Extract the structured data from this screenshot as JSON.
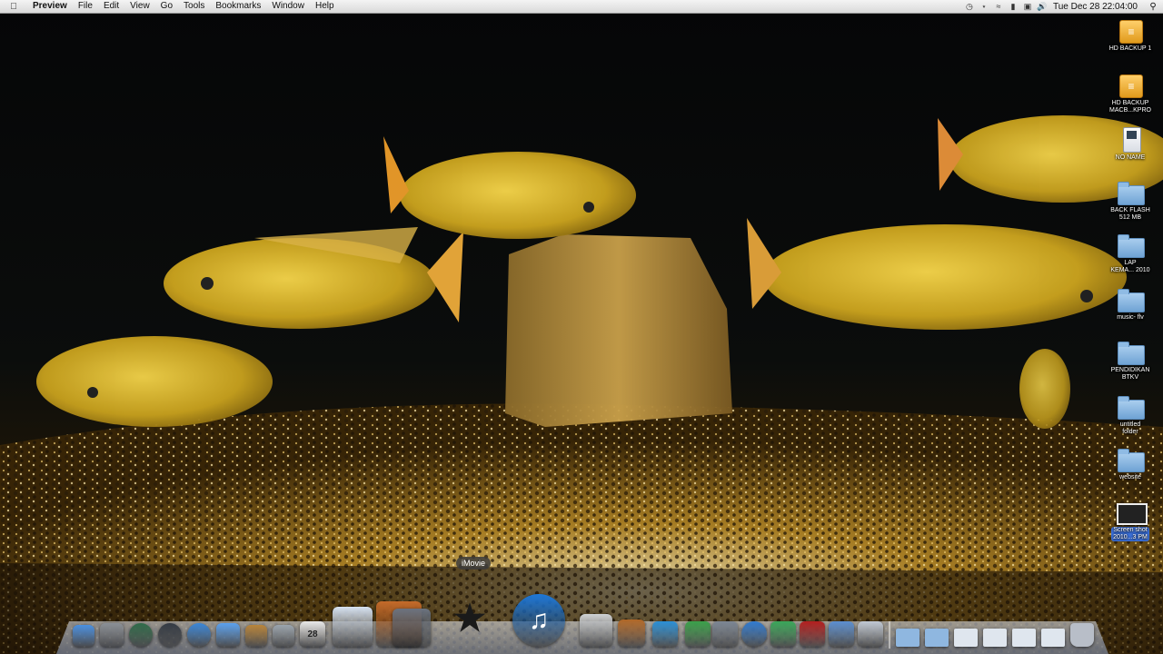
{
  "menubar": {
    "app_name": "Preview",
    "items": [
      "File",
      "Edit",
      "View",
      "Go",
      "Tools",
      "Bookmarks",
      "Window",
      "Help"
    ],
    "status_icons": [
      "time-machine-icon",
      "bluetooth-icon",
      "wifi-icon",
      "battery-icon",
      "keyboard-flag-icon",
      "volume-icon"
    ],
    "clock": "Tue Dec 28  22:04:00"
  },
  "desktop": {
    "items": [
      {
        "label": "HD BACKUP 1",
        "kind": "usb-drive-icon"
      },
      {
        "label": "HD BACKUP\nMACB...KPRO",
        "kind": "usb-drive-icon"
      },
      {
        "label": "NO NAME",
        "kind": "sd-card-icon"
      },
      {
        "label": "BACK FLASH\n512 MB",
        "kind": "folder-icon"
      },
      {
        "label": "LAP\nKEMA... 2010",
        "kind": "folder-icon"
      },
      {
        "label": "music- flv",
        "kind": "folder-icon"
      },
      {
        "label": "PENDIDIKAN\nBTKV",
        "kind": "folder-icon"
      },
      {
        "label": "untitled\nfolder",
        "kind": "folder-icon"
      },
      {
        "label": "website",
        "kind": "folder-icon"
      },
      {
        "label": "Screen shot\n2010...3 PM",
        "kind": "screenshot-file-icon"
      }
    ]
  },
  "dock": {
    "tooltip": "iMovie",
    "apps": [
      {
        "name": "finder-icon",
        "color": "#4a8fe0"
      },
      {
        "name": "system-preferences-icon",
        "color": "#8a8f96"
      },
      {
        "name": "time-machine-icon",
        "color": "#2f6b4a"
      },
      {
        "name": "dashboard-icon",
        "color": "#333a44"
      },
      {
        "name": "safari-icon",
        "color": "#3a86d8"
      },
      {
        "name": "ichat-icon",
        "color": "#5aa0ee"
      },
      {
        "name": "address-book-icon",
        "color": "#b8843a"
      },
      {
        "name": "sync-icon",
        "color": "#9aa4ae"
      },
      {
        "name": "ical-icon",
        "color": "#e9e9e9",
        "text": "28"
      },
      {
        "name": "preview-icon",
        "color": "#d7e3f3"
      },
      {
        "name": "iphoto-icon",
        "color": "#c56b2a"
      },
      {
        "name": "image-capture-icon",
        "color": "#6b7380"
      },
      {
        "name": "imovie-icon",
        "color": "#c2a34a"
      },
      {
        "name": "itunes-icon",
        "color": "#1e78d8"
      },
      {
        "name": "dvd-player-icon",
        "color": "#cfd2d6"
      },
      {
        "name": "garageband-icon",
        "color": "#b36a2a"
      },
      {
        "name": "iweb-icon",
        "color": "#2a8fd6"
      },
      {
        "name": "network-utility-icon",
        "color": "#3aa04a"
      },
      {
        "name": "scanner-icon",
        "color": "#7c8694"
      },
      {
        "name": "home-icon",
        "color": "#2f7ad0"
      },
      {
        "name": "messenger-icon",
        "color": "#3aa65a"
      },
      {
        "name": "photo-booth-icon",
        "color": "#b31f1f"
      },
      {
        "name": "network-globe-icon",
        "color": "#5b8ed0"
      },
      {
        "name": "photo-browser-icon",
        "color": "#c0c8d4"
      }
    ],
    "stacks": [
      {
        "name": "applications-stack-icon",
        "color": "#8fb7e0"
      },
      {
        "name": "documents-stack-icon",
        "color": "#8fb7e0"
      },
      {
        "name": "window-stack-icon",
        "color": "#dfe6ee"
      },
      {
        "name": "window-stack-icon",
        "color": "#dfe6ee"
      },
      {
        "name": "window-stack-icon",
        "color": "#dfe6ee"
      },
      {
        "name": "window-stack-icon",
        "color": "#dfe6ee"
      },
      {
        "name": "trash-icon",
        "color": "#b8bec8"
      }
    ]
  }
}
